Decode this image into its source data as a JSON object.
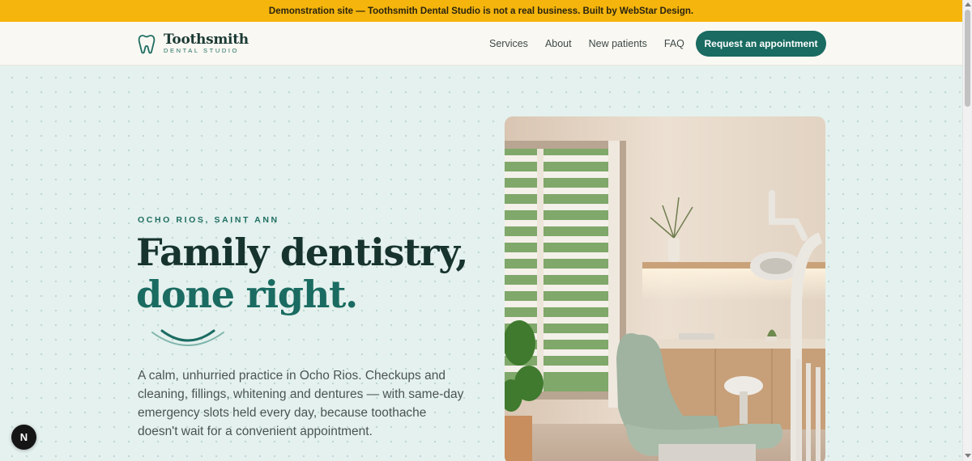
{
  "banner": {
    "text": "Demonstration site — Toothsmith Dental Studio is not a real business. Built by WebStar Design."
  },
  "brand": {
    "name": "Toothsmith",
    "tagline": "DENTAL STUDIO",
    "logo_icon": "tooth-icon"
  },
  "nav": {
    "links": [
      "Services",
      "About",
      "New patients",
      "FAQ"
    ],
    "cta": "Request an appointment"
  },
  "hero": {
    "eyebrow": "OCHO RIOS, SAINT ANN",
    "headline_line1": "Family dentistry,",
    "headline_line2": "done right.",
    "lede": "A calm, unhurried practice in Ocho Rios. Checkups and cleaning, fillings, whitening and dentures — with same-day emergency slots held every day, because toothache doesn't wait for a convenient appointment.",
    "image": "dental-treatment-room-photo"
  },
  "devtools": {
    "label": "N"
  },
  "colors": {
    "banner": "#f5b50c",
    "brand": "#1a6b61",
    "headline": "#17332e",
    "background": "#e4f1ee"
  }
}
